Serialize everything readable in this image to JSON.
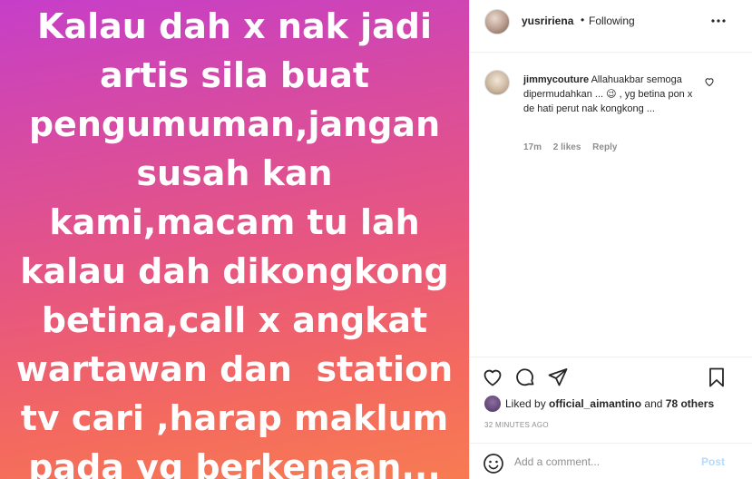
{
  "media": {
    "lines": [
      "Kalau dah x nak jadi",
      "artis sila buat",
      "pengumuman,jangan",
      "susah kan",
      "kami,macam tu lah",
      "kalau dah dikongkong",
      "betina,call x angkat",
      "wartawan dan  station",
      "tv cari ,harap maklum",
      "pada yg berkenaan..."
    ],
    "gradient_colors": [
      "#c63ec9",
      "#e8577e",
      "#f77b52"
    ]
  },
  "header": {
    "username": "yusririena",
    "separator": "•",
    "follow_status": "Following",
    "more_icon": "more-horizontal-icon"
  },
  "comment": {
    "username": "jimmycouture",
    "text": "Allahuakbar semoga dipermudahkan ... 😉 , yg betina pon x de hati perut nak kongkong ...",
    "time": "17m",
    "likes": "2 likes",
    "reply": "Reply"
  },
  "actions": {
    "icons": [
      "heart-icon",
      "comment-icon",
      "share-icon",
      "bookmark-icon"
    ],
    "liked_by_prefix": "Liked by",
    "liked_by_user": "official_aimantino",
    "liked_by_and": "and",
    "liked_by_others": "78 others",
    "timestamp": "32 MINUTES AGO"
  },
  "add_comment": {
    "placeholder": "Add a comment...",
    "post_label": "Post"
  },
  "colors": {
    "link_disabled": "#b3dbff",
    "muted_text": "#8e8e8e",
    "border": "#efefef"
  }
}
